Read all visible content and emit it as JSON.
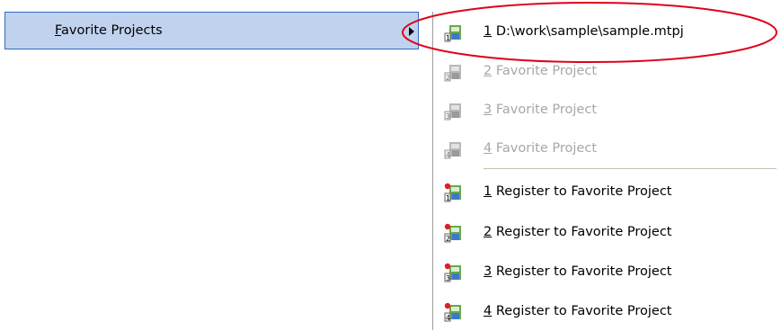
{
  "menu": {
    "parent_item": {
      "mnemonic": "F",
      "label_rest": "avorite Projects"
    },
    "submenu_items": [
      {
        "num": "1",
        "text": " D:\\work\\sample\\sample.mtpj",
        "enabled": true
      },
      {
        "num": "2",
        "text": " Favorite Project",
        "enabled": false
      },
      {
        "num": "3",
        "text": " Favorite Project",
        "enabled": false
      },
      {
        "num": "4",
        "text": " Favorite Project",
        "enabled": false
      },
      {
        "num": "1",
        "text": " Register to Favorite Project",
        "enabled": true
      },
      {
        "num": "2",
        "text": " Register to Favorite Project",
        "enabled": true
      },
      {
        "num": "3",
        "text": " Register to Favorite Project",
        "enabled": true
      },
      {
        "num": "4",
        "text": " Register to Favorite Project",
        "enabled": true
      }
    ]
  },
  "icons": {
    "submenu_arrow": "triangle-right-icon",
    "project": "project-icon",
    "register": "register-favorite-icon"
  },
  "colors": {
    "highlight_bg": "#c1d2ee",
    "highlight_border": "#316ac5",
    "disabled_text": "#a7a6aa",
    "annotation_ellipse": "#e0001b"
  }
}
